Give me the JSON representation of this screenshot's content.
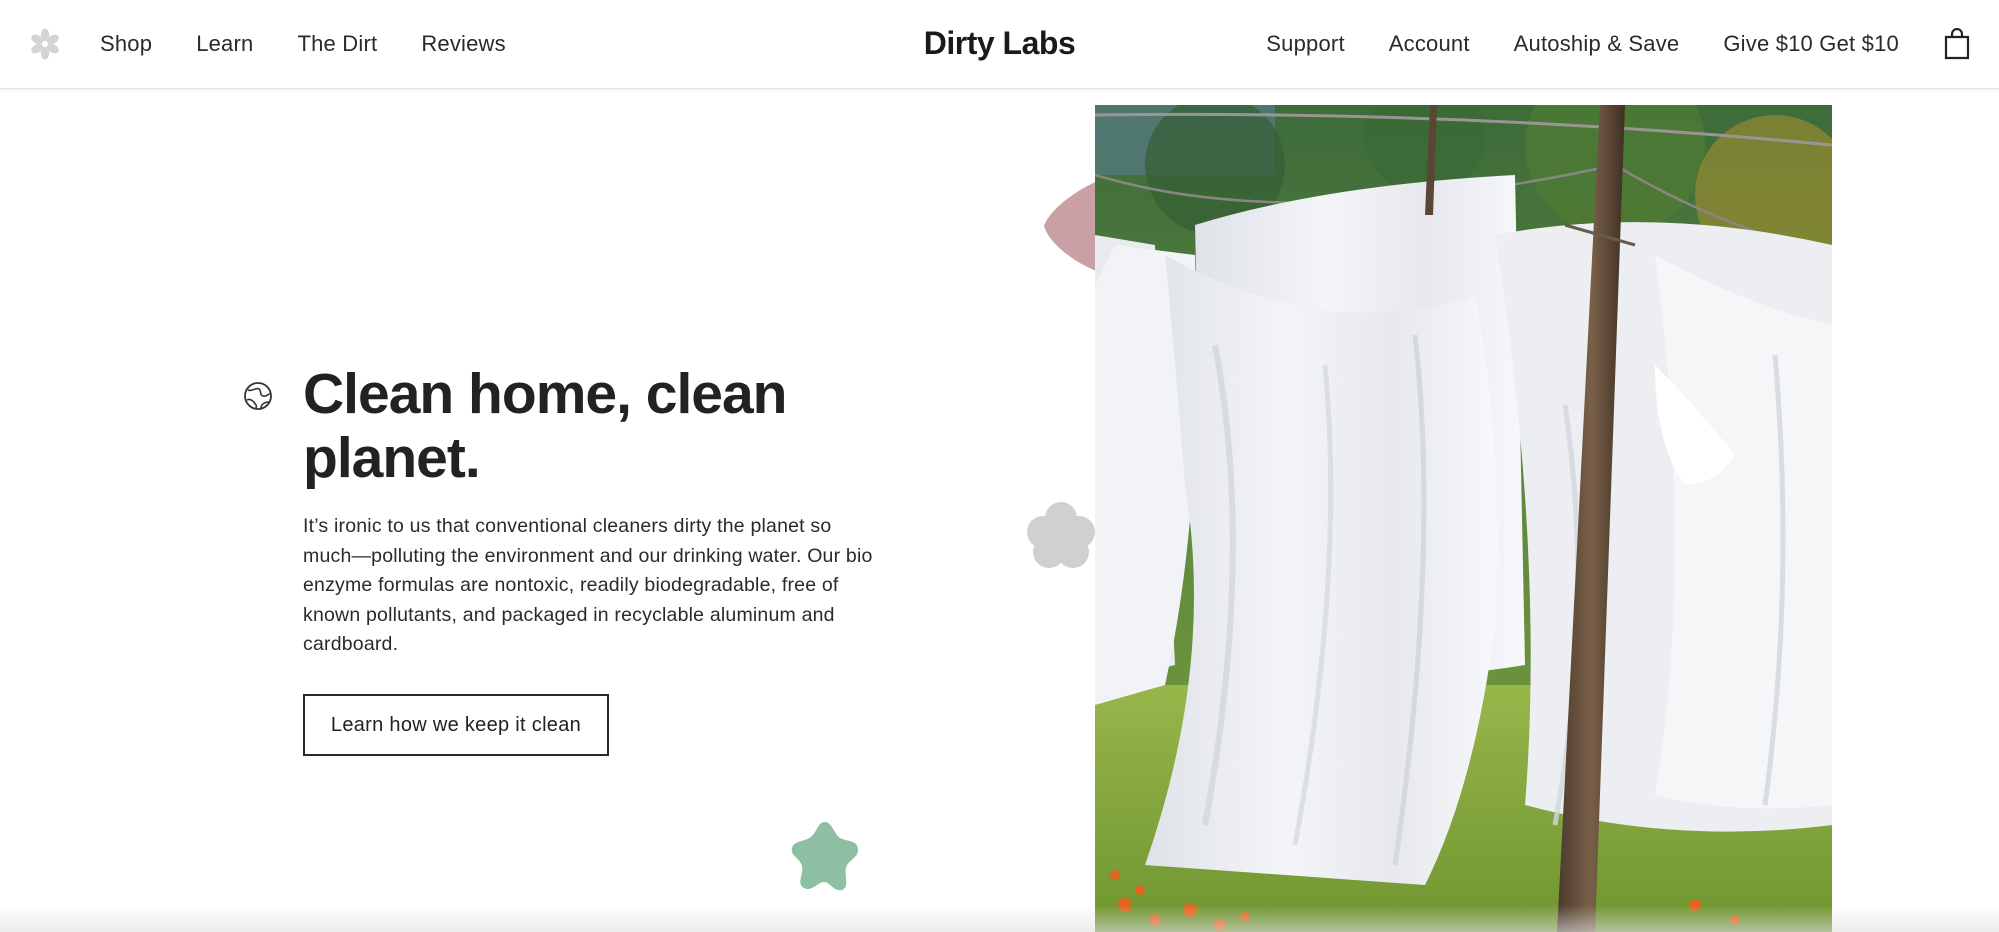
{
  "header": {
    "brand": "Dirty Labs",
    "logo_icon": "snowflake-flower-icon",
    "nav_left": [
      {
        "label": "Shop"
      },
      {
        "label": "Learn"
      },
      {
        "label": "The Dirt"
      },
      {
        "label": "Reviews"
      }
    ],
    "nav_right": [
      {
        "label": "Support"
      },
      {
        "label": "Account"
      },
      {
        "label": "Autoship & Save"
      },
      {
        "label": "Give $10 Get $10"
      }
    ],
    "cart_icon": "shopping-bag-icon"
  },
  "hero": {
    "icon": "globe-icon",
    "headline": "Clean home, clean planet.",
    "body": "It’s ironic to us that conventional cleaners dirty the planet so much—polluting the environment and our drinking water. Our bio enzyme formulas are nontoxic, readily biodegradable, free of known pollutants, and packaged in recyclable aluminum and cardboard.",
    "cta_label": "Learn how we keep it clean",
    "image_alt_icon": "laundry-on-clothesline-photo"
  },
  "colors": {
    "text": "#222222",
    "deco_pink": "#c9a0a3",
    "deco_gray": "#cfcfcf",
    "deco_green": "#8dbfa3",
    "grass": "#7fa035",
    "sheet": "#eef0f4"
  }
}
